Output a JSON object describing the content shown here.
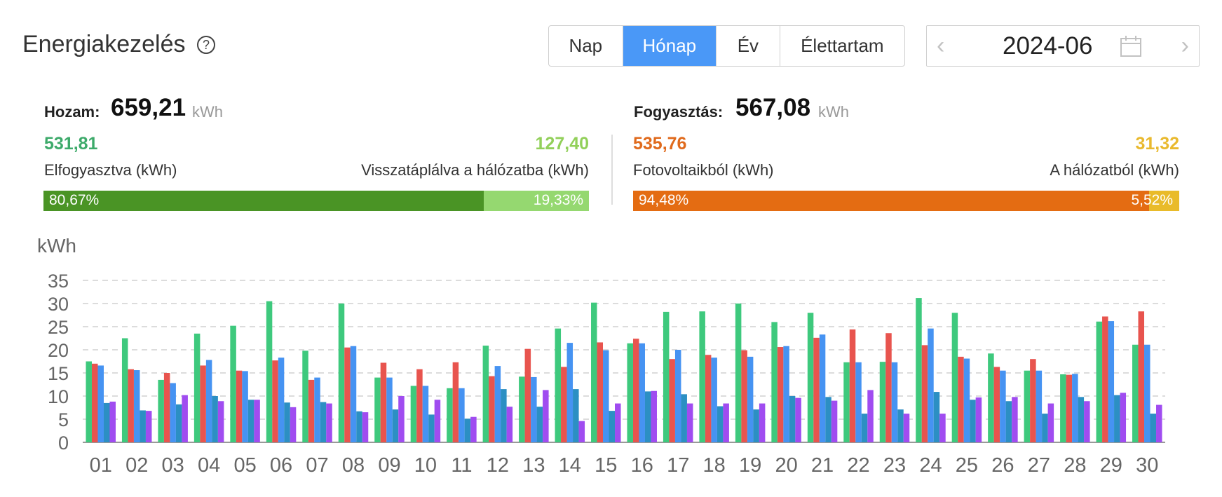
{
  "header": {
    "title": "Energiakezelés",
    "help_icon": "question-circle-icon",
    "tabs": [
      {
        "label": "Nap",
        "active": false
      },
      {
        "label": "Hónap",
        "active": true
      },
      {
        "label": "Év",
        "active": false
      },
      {
        "label": "Élettartam",
        "active": false
      }
    ],
    "date": "2024-06",
    "date_prev_icon": "chevron-left-icon",
    "date_next_icon": "chevron-right-icon",
    "calendar_icon": "calendar-icon"
  },
  "yield": {
    "label": "Hozam:",
    "value": "659,21",
    "unit": "kWh",
    "left_value": "531,81",
    "left_desc": "Elfogyasztva (kWh)",
    "right_value": "127,40",
    "right_desc": "Visszatáplálva a hálózatba (kWh)",
    "left_pct_label": "80,67%",
    "right_pct_label": "19,33%",
    "left_fraction": 0.8067,
    "left_color": "#4a9425",
    "right_color": "#95d870",
    "left_value_color": "#3daa6a",
    "right_value_color": "#92d05a"
  },
  "consumption": {
    "label": "Fogyasztás:",
    "value": "567,08",
    "unit": "kWh",
    "left_value": "535,76",
    "left_desc": "Fotovoltaikból (kWh)",
    "right_value": "31,32",
    "right_desc": "A hálózatból (kWh)",
    "left_pct_label": "94,48%",
    "right_pct_label": "5,52%",
    "left_fraction": 0.9448,
    "left_color": "#e46c12",
    "right_color": "#e9bb2a",
    "left_value_color": "#e06a1c",
    "right_value_color": "#e9b92e"
  },
  "chart_data": {
    "type": "bar",
    "ylabel": "kWh",
    "ylim": [
      0,
      35
    ],
    "yticks": [
      0,
      5,
      10,
      15,
      20,
      25,
      30,
      35
    ],
    "grid": true,
    "categories": [
      "01",
      "02",
      "03",
      "04",
      "05",
      "06",
      "07",
      "08",
      "09",
      "10",
      "11",
      "12",
      "13",
      "14",
      "15",
      "16",
      "17",
      "18",
      "19",
      "20",
      "21",
      "22",
      "23",
      "24",
      "25",
      "26",
      "27",
      "28",
      "29",
      "30"
    ],
    "series": [
      {
        "color": "#3ec97d",
        "values": [
          17.5,
          22.5,
          13.5,
          23.5,
          25.2,
          30.5,
          19.8,
          30,
          14,
          12.2,
          11.7,
          20.9,
          14.2,
          24.6,
          30.2,
          21.4,
          28.2,
          28.3,
          30,
          26,
          28,
          17.3,
          17.4,
          31.2,
          28,
          19.2,
          15.5,
          14.7,
          26.1,
          21.1
        ]
      },
      {
        "color": "#e8544e",
        "values": [
          17,
          15.8,
          15,
          16.6,
          15.5,
          17.7,
          13.5,
          20.5,
          17.2,
          15.8,
          17.3,
          14.3,
          20.2,
          16.3,
          21.6,
          22.4,
          18,
          18.9,
          19.9,
          20.6,
          22.6,
          24.4,
          23.6,
          21,
          18.5,
          16.3,
          18,
          14.6,
          27.2,
          28.3
        ]
      },
      {
        "color": "#4693f2",
        "values": [
          16.6,
          15.6,
          12.8,
          17.8,
          15.4,
          18.3,
          14,
          20.8,
          14,
          12.2,
          11.7,
          16.5,
          14.1,
          21.5,
          19.9,
          21.4,
          20,
          18.3,
          18.5,
          20.8,
          23.3,
          17.3,
          17.3,
          24.6,
          18.1,
          15.5,
          15.5,
          14.8,
          26.2,
          21.1
        ]
      },
      {
        "color": "#2c8fc3",
        "values": [
          8.5,
          6.9,
          8.2,
          10,
          9.2,
          8.6,
          8.7,
          6.7,
          7.1,
          6,
          5.1,
          11.5,
          7.7,
          11.5,
          6.8,
          11,
          10.4,
          7.8,
          7.1,
          10,
          9.8,
          6.2,
          7.1,
          10.9,
          9.2,
          8.9,
          6.2,
          9.8,
          10.2,
          6.2
        ]
      },
      {
        "color": "#a04cf0",
        "values": [
          8.8,
          6.8,
          10.2,
          8.9,
          9.2,
          7.6,
          8.4,
          6.5,
          10,
          9.2,
          5.5,
          7.7,
          11.3,
          4.6,
          8.4,
          11.1,
          8.4,
          8.4,
          8.4,
          9.6,
          9,
          11.3,
          6.2,
          6.2,
          9.7,
          9.8,
          8.4,
          8.9,
          10.7,
          8.1
        ]
      }
    ]
  }
}
